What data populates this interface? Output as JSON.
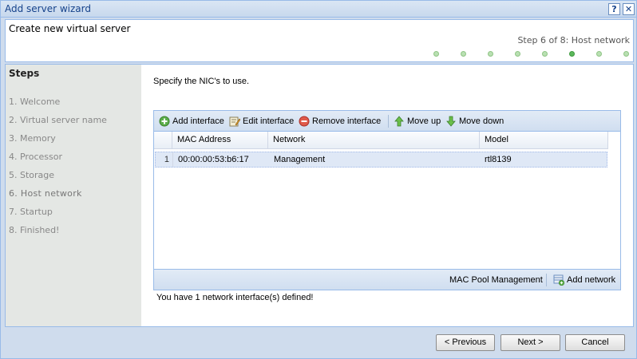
{
  "window": {
    "title": "Add server wizard",
    "help_label": "?",
    "close_label": "✕"
  },
  "header": {
    "title": "Create new virtual server",
    "step_indicator": "Step 6 of 8: Host network",
    "progress": {
      "total": 8,
      "current": 6
    }
  },
  "steps": {
    "title": "Steps",
    "items": [
      {
        "label": "1. Welcome"
      },
      {
        "label": "2. Virtual server name"
      },
      {
        "label": "3. Memory"
      },
      {
        "label": "4. Processor"
      },
      {
        "label": "5. Storage"
      },
      {
        "label": "6. Host network"
      },
      {
        "label": "7. Startup"
      },
      {
        "label": "8. Finished!"
      }
    ]
  },
  "content": {
    "instruction": "Specify the NIC's to use.",
    "toolbar": {
      "add": "Add interface",
      "edit": "Edit interface",
      "remove": "Remove interface",
      "up": "Move up",
      "down": "Move down"
    },
    "columns": [
      "MAC Address",
      "Network",
      "Model"
    ],
    "rows": [
      {
        "num": "1",
        "mac": "00:00:00:53:b6:17",
        "network": "Management",
        "model": "rtl8139"
      }
    ],
    "footer": {
      "mac_pool": "MAC Pool Management",
      "add_network": "Add network"
    },
    "count_text": "You have 1 network interface(s) defined!"
  },
  "buttons": {
    "previous": "< Previous",
    "next": "Next >",
    "cancel": "Cancel"
  },
  "colors": {
    "accent": "#15428b",
    "border": "#99bbe8",
    "progress_done": "#b9e0b2",
    "progress_active": "#5cb85c"
  }
}
